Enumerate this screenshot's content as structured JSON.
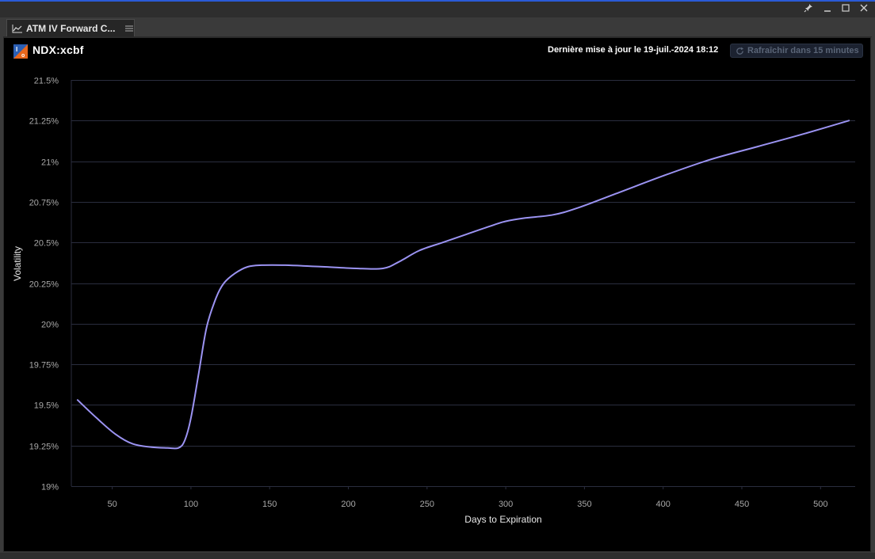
{
  "window": {
    "controls": [
      "pin-icon",
      "minimize-icon",
      "maximize-icon",
      "close-icon"
    ]
  },
  "tab": {
    "title": "ATM IV Forward C...",
    "icon": "line-chart-icon",
    "menu_icon": "hamburger-menu-icon"
  },
  "header": {
    "symbol": "NDX:xcbf",
    "logo_icon": "ivolatility-logo-icon",
    "last_update": "Dernière mise à jour le 19-juil.-2024 18:12",
    "refresh_label": "Rafraîchir dans 15 minutes"
  },
  "colors": {
    "panel_bg": "#000000",
    "line": "#9b93f2",
    "grid": "#2a2d3e",
    "window_border": "#2a5bd7"
  },
  "chart_data": {
    "type": "line",
    "xlabel": "Days to Expiration",
    "ylabel": "Volatility",
    "xlim": [
      24,
      522
    ],
    "ylim": [
      19.0,
      21.5
    ],
    "x_ticks": [
      50,
      100,
      150,
      200,
      250,
      300,
      350,
      400,
      450,
      500
    ],
    "x_tick_labels": [
      "50",
      "100",
      "150",
      "200",
      "250",
      "300",
      "350",
      "400",
      "450",
      "500"
    ],
    "y_ticks": [
      19.0,
      19.25,
      19.5,
      19.75,
      20.0,
      20.25,
      20.5,
      20.75,
      21.0,
      21.25,
      21.5
    ],
    "y_tick_labels": [
      "19%",
      "19.25%",
      "19.5%",
      "19.75%",
      "20%",
      "20.25%",
      "20.5%",
      "20.75%",
      "21%",
      "21.25%",
      "21.5%"
    ],
    "grid": true,
    "series": [
      {
        "x": [
          28,
          40,
          52,
          63,
          75,
          85,
          92,
          96,
          100,
          105,
          110,
          116,
          121,
          128,
          136,
          145,
          160,
          185,
          205,
          222,
          232,
          245,
          260,
          275,
          290,
          300,
          312,
          330,
          345,
          370,
          400,
          430,
          460,
          490,
          518
        ],
        "y": [
          19.53,
          19.42,
          19.32,
          19.26,
          19.24,
          19.235,
          19.235,
          19.28,
          19.42,
          19.7,
          19.98,
          20.16,
          20.25,
          20.31,
          20.35,
          20.36,
          20.36,
          20.35,
          20.34,
          20.34,
          20.38,
          20.45,
          20.5,
          20.55,
          20.6,
          20.63,
          20.65,
          20.67,
          20.71,
          20.8,
          20.91,
          21.01,
          21.09,
          21.17,
          21.25
        ]
      }
    ]
  }
}
